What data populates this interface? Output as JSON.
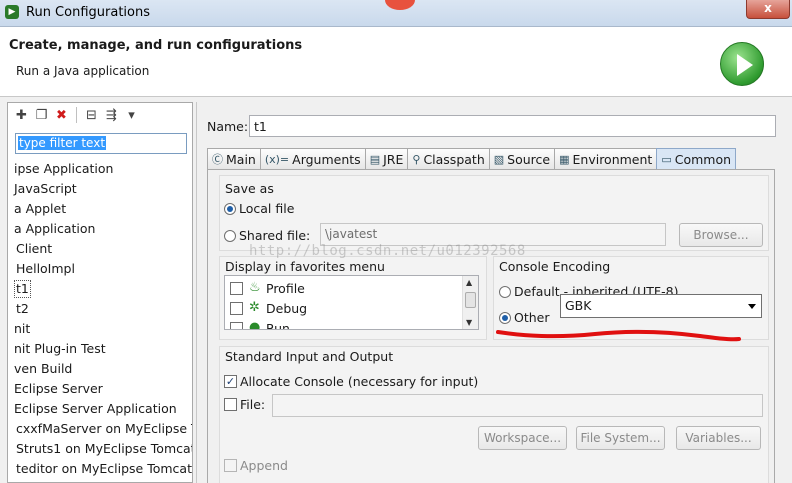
{
  "window": {
    "title": "Run Configurations",
    "close_glyph": "x"
  },
  "header": {
    "title": "Create, manage, and run configurations",
    "subtitle": "Run a Java application",
    "badge_icon": "run-icon"
  },
  "left": {
    "toolbar_icons": [
      "new-config-icon",
      "duplicate-icon",
      "delete-icon",
      "collapse-all-icon",
      "filter-icon",
      "dropdown-arrow-icon"
    ],
    "filter_text": "type filter text",
    "tree_items": [
      "ipse Application",
      "JavaScript",
      "a Applet",
      "a Application",
      "Client",
      "HelloImpl",
      "t1",
      "t2",
      "nit",
      "nit Plug-in Test",
      "ven Build",
      "Eclipse Server",
      "Eclipse Server Application",
      "cxxfMaServer on MyEclipse T",
      "Struts1 on MyEclipse Tomcat",
      "teditor on MyEclipse Tomcat"
    ],
    "selected_index": 6
  },
  "name": {
    "label": "Name:",
    "value": "t1"
  },
  "tabs": [
    {
      "label": "Main",
      "icon": "main-tab-icon"
    },
    {
      "label": "Arguments",
      "icon": "arguments-tab-icon"
    },
    {
      "label": "JRE",
      "icon": "jre-tab-icon"
    },
    {
      "label": "Classpath",
      "icon": "classpath-tab-icon"
    },
    {
      "label": "Source",
      "icon": "source-tab-icon"
    },
    {
      "label": "Environment",
      "icon": "environment-tab-icon"
    },
    {
      "label": "Common",
      "icon": "common-tab-icon"
    }
  ],
  "active_tab": "Common",
  "save_as": {
    "title": "Save as",
    "local_label": "Local file",
    "shared_label": "Shared file:",
    "shared_value": "\\javatest",
    "browse_label": "Browse..."
  },
  "favorites": {
    "title": "Display in favorites menu",
    "items": [
      "Profile",
      "Debug",
      "Run"
    ]
  },
  "encoding": {
    "title": "Console Encoding",
    "default_label": "Default - inherited (UTF-8)",
    "other_label": "Other",
    "other_value": "GBK"
  },
  "std_io": {
    "title": "Standard Input and Output",
    "allocate_label": "Allocate Console (necessary for input)",
    "file_label": "File:",
    "workspace_label": "Workspace...",
    "filesystem_label": "File System...",
    "variables_label": "Variables...",
    "append_label": "Append"
  },
  "watermark": "http://blog.csdn.net/u012392568",
  "colors": {
    "annotation_red": "#e01010",
    "selection_blue": "#3399ff"
  }
}
